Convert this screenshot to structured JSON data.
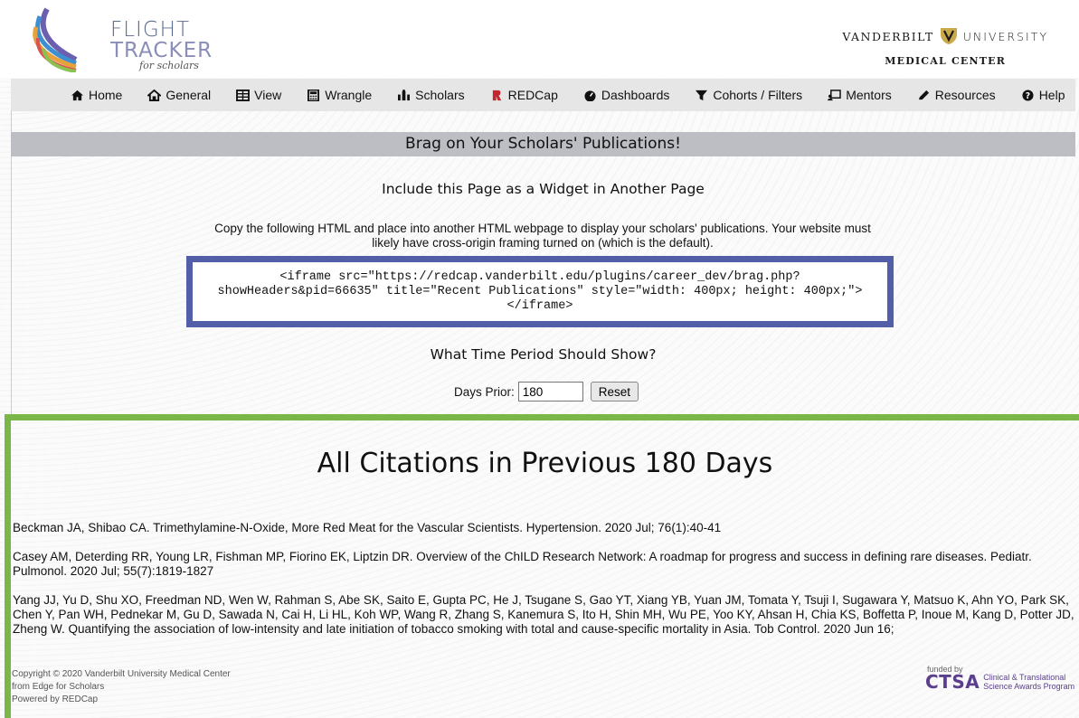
{
  "header": {
    "logo_line1": "FLIGHT",
    "logo_line2": "TRACKER",
    "logo_line3": "for scholars",
    "institution_line1a": "VANDERBILT",
    "institution_line1b": "UNIVERSITY",
    "institution_line2": "MEDICAL CENTER"
  },
  "nav": {
    "items": [
      {
        "label": "Home",
        "icon": "home-icon"
      },
      {
        "label": "General",
        "icon": "general-icon"
      },
      {
        "label": "View",
        "icon": "table-icon"
      },
      {
        "label": "Wrangle",
        "icon": "calculator-icon"
      },
      {
        "label": "Scholars",
        "icon": "scholars-icon"
      },
      {
        "label": "REDCap",
        "icon": "redcap-icon"
      },
      {
        "label": "Dashboards",
        "icon": "dashboard-icon"
      },
      {
        "label": "Cohorts / Filters",
        "icon": "filter-icon"
      },
      {
        "label": "Mentors",
        "icon": "mentors-icon"
      },
      {
        "label": "Resources",
        "icon": "pen-icon"
      },
      {
        "label": "Help",
        "icon": "help-icon"
      }
    ]
  },
  "main": {
    "title": "Brag on Your Scholars' Publications!",
    "widget_heading": "Include this Page as a Widget in Another Page",
    "widget_description": "Copy the following HTML and place into another HTML webpage to display your scholars' publications. Your website must likely have cross-origin framing turned on (which is the default).",
    "embed_code": "<iframe src=\"https://redcap.vanderbilt.edu/plugins/career_dev/brag.php?showHeaders&pid=66635\" title=\"Recent Publications\" style=\"width: 400px; height: 400px;\"></iframe>",
    "period_heading": "What Time Period Should Show?",
    "days_label": "Days Prior:",
    "days_value": "180",
    "reset_label": "Reset"
  },
  "embed": {
    "heading": "All Citations in Previous 180 Days",
    "citations": [
      "Beckman JA, Shibao CA. Trimethylamine-N-Oxide, More Red Meat for the Vascular Scientists. Hypertension. 2020 Jul; 76(1):40-41",
      "Casey AM, Deterding RR, Young LR, Fishman MP, Fiorino EK, Liptzin DR. Overview of the ChILD Research Network: A roadmap for progress and success in defining rare diseases. Pediatr. Pulmonol. 2020 Jul; 55(7):1819-1827",
      "Yang JJ, Yu D, Shu XO, Freedman ND, Wen W, Rahman S, Abe SK, Saito E, Gupta PC, He J, Tsugane S, Gao YT, Xiang YB, Yuan JM, Tomata Y, Tsuji I, Sugawara Y, Matsuo K, Ahn YO, Park SK, Chen Y, Pan WH, Pednekar M, Gu D, Sawada N, Cai H, Li HL, Koh WP, Wang R, Zhang S, Kanemura S, Ito H, Shin MH, Wu PE, Yoo KY, Ahsan H, Chia KS, Boffetta P, Inoue M, Kang D, Potter JD, Zheng W. Quantifying the association of low-intensity and late initiation of tobacco smoking with total and cause-specific mortality in Asia. Tob Control. 2020 Jun 16;"
    ],
    "footer_line1": "Copyright © 2020 Vanderbilt University Medical Center",
    "footer_line2": "from Edge for Scholars",
    "footer_line3": "Powered by REDCap",
    "ctsa_funded": "funded by",
    "ctsa_big": "CTSA",
    "ctsa_small1": "Clinical & Translational",
    "ctsa_small2": "Science Awards Program"
  },
  "colors": {
    "nav_bg": "#e6e6e6",
    "title_bg": "#bcbec4",
    "code_border": "#535ea9",
    "embed_border": "#7ab648",
    "ctsa_purple": "#5b3f8c"
  }
}
